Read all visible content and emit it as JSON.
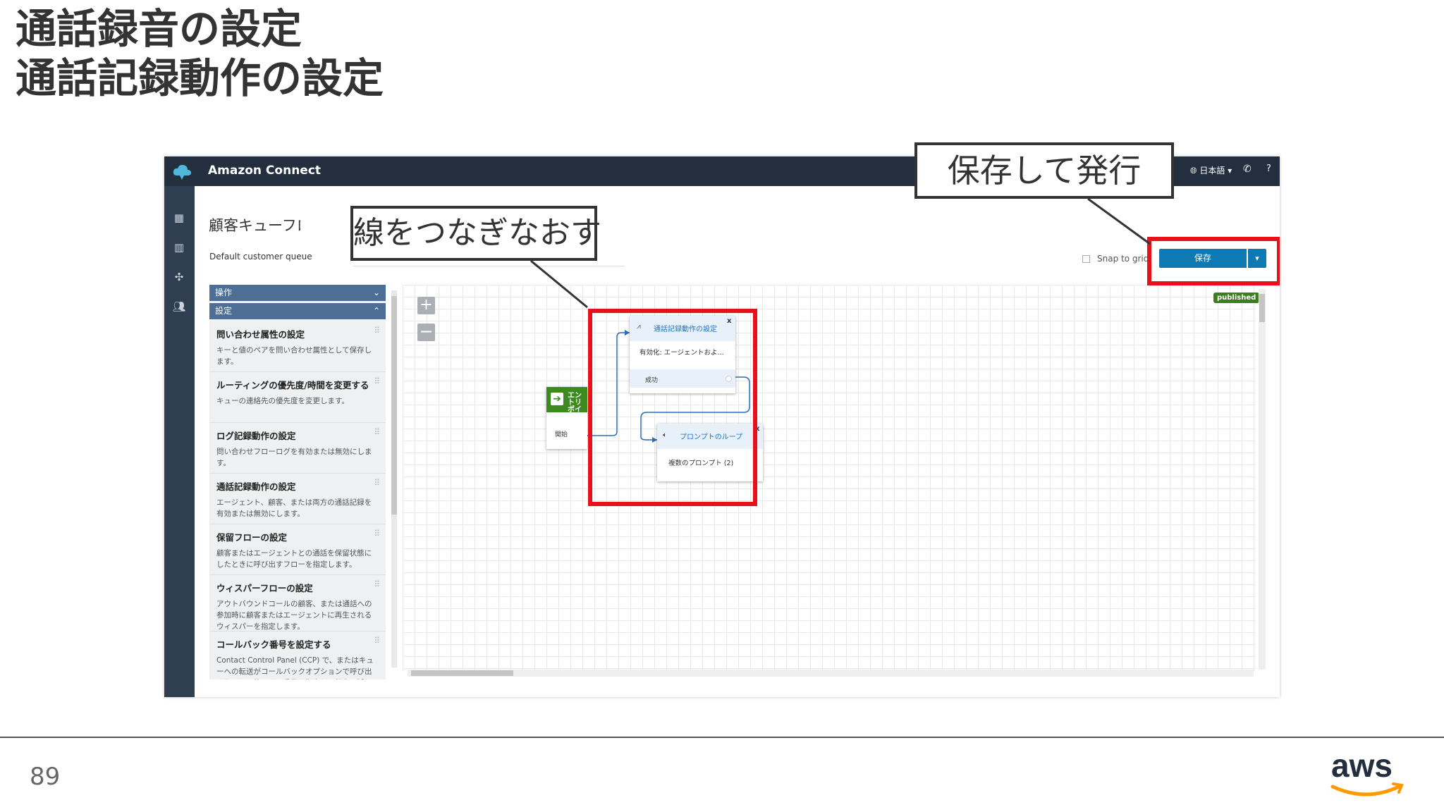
{
  "slide": {
    "title_line1": "通話録音の設定",
    "title_line2": "通話記録動作の設定",
    "page_number": "89",
    "logo": "aws"
  },
  "app": {
    "name": "Amazon Connect",
    "language": "日本語",
    "help": "?"
  },
  "nav_icons": [
    "dashboard-icon",
    "metrics-icon",
    "routing-icon",
    "users-icon"
  ],
  "flow": {
    "title": "顧客キューフローの",
    "description": "Default customer queue",
    "snap_to_grid": "Snap to grid",
    "save_label": "保存",
    "status_badge": "published"
  },
  "panel": {
    "operations_header": "操作",
    "settings_header": "設定",
    "items": [
      {
        "title": "問い合わせ属性の設定",
        "desc": "キーと値のペアを問い合わせ属性として保存します。"
      },
      {
        "title": "ルーティングの優先度/時間を変更する",
        "desc": "キューの連絡先の優先度を変更します。"
      },
      {
        "title": "ログ記録動作の設定",
        "desc": "問い合わせフローログを有効または無効にします。"
      },
      {
        "title": "通話記録動作の設定",
        "desc": "エージェント、顧客、または両方の通話記録を有効または無効にします。"
      },
      {
        "title": "保留フローの設定",
        "desc": "顧客またはエージェントとの通話を保留状態にしたときに呼び出すフローを指定します。"
      },
      {
        "title": "ウィスパーフローの設定",
        "desc": "アウトバウンドコールの顧客、または通話への参加時に顧客またはエージェントに再生されるウィスパーを指定します。"
      },
      {
        "title": "コールバック番号を設定する",
        "desc": "Contact Control Panel (CCP) で、またはキューへの転送がコールバックオプションで呼び出されると、使用する番号を指定して顧客に折り返し電話をかけ"
      }
    ]
  },
  "blocks": {
    "entry": {
      "label": "エントリポイント",
      "start": "開始"
    },
    "recording": {
      "title": "通話記録動作の設定",
      "body": "有効化: エージェントおよ...",
      "success": "成功"
    },
    "prompt": {
      "title": "プロンプトのループ",
      "body": "複数のプロンプト (2)"
    }
  },
  "callouts": {
    "rewire": "線をつなぎなおす",
    "save": "保存して発行"
  },
  "colors": {
    "topbar": "#232f3e",
    "highlight": "#e8101b",
    "save_button": "#0e79b2",
    "published": "#3e7d1e",
    "entry": "#3d8b1f"
  }
}
